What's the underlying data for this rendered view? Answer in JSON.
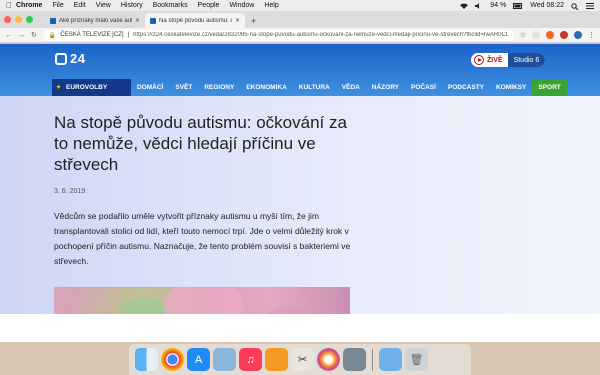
{
  "menubar": {
    "app": "Chrome",
    "items": [
      "File",
      "Edit",
      "View",
      "History",
      "Bookmarks",
      "People",
      "Window",
      "Help"
    ],
    "battery": "94 %",
    "clock": "Wed 08:22"
  },
  "tabs": [
    {
      "title": "Aké príznaky malo vaše autism...",
      "active": false
    },
    {
      "title": "Na stopě původu autismu: očk...",
      "active": true
    }
  ],
  "toolbar": {
    "site_label": "ČESKÁ TELEVIZE [CZ]",
    "url": "https://ct24.ceskatelevize.cz/veda/2832095-na-stope-puvodu-autismu-ockovani-za-nemuze-vedci-hledaji-pricinu-ve-strevech?fbclid=IwAR0CDw..."
  },
  "site": {
    "logo": "24",
    "live_label": "ŽIVĚ",
    "studio_label": "Studio 6",
    "nav": [
      "EUROVOLBY",
      "DOMÁCÍ",
      "SVĚT",
      "REGIONY",
      "EKONOMIKA",
      "KULTURA",
      "VĚDA",
      "NÁZORY",
      "POČASÍ",
      "PODCASTY",
      "KOMIKSY",
      "SPORT"
    ],
    "colors": {
      "header": "#1c63c9",
      "eurovolby": "#133a8a",
      "sport": "#3aa335",
      "live": "#b4161b"
    }
  },
  "article": {
    "headline": "Na stopě původu autismu: očkování za to nemůže, vědci hledají příčinu ve střevech",
    "date": "3. 6. 2019",
    "perex": "Vědcům se podařilo uměle vytvořit příznaky autismu u myší tím, že jim transplantovali stolici od lidí, kteří touto nemocí trpí. Jde o velmi důležitý krok v pochopení příčin autismu. Naznačuje, že tento problém souvisí s bakteriemi ve střevech."
  },
  "dock": [
    "finder-icon",
    "chrome-icon",
    "app-store-icon",
    "preview-icon",
    "music-icon",
    "books-icon",
    "tools-icon",
    "photos-icon",
    "image-capture-icon",
    "downloads-folder-icon",
    "trash-icon"
  ]
}
